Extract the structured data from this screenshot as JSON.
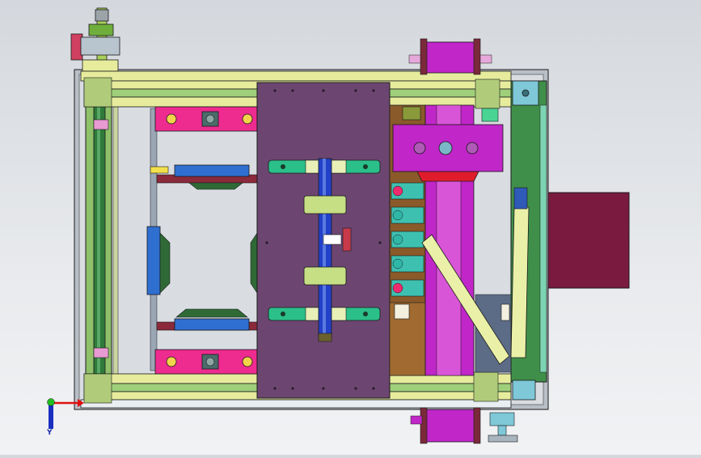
{
  "viewport": {
    "background_top": "#d4d8dd",
    "background_bottom": "#f1f2f4"
  },
  "colors": {
    "outline": "#1a1a1a",
    "frame_gray": "#b9bfc6",
    "rail_yellow": "#e6ec9c",
    "rail_green": "#8fc06a",
    "column_green": "#3f8f4a",
    "plate_purple": "#6c4670",
    "magenta": "#ee2b8f",
    "violet": "#c026c8",
    "clamp_green": "#2bbf8a",
    "rod_blue": "#2340c8",
    "bracket_blue": "#2f6fd0",
    "red_block": "#e01c2c",
    "maroon_box": "#7a1a3e",
    "brown_panel": "#8a5a2a",
    "teal": "#2fb7a8",
    "slate": "#5c6c86",
    "axis_x": "#e01010",
    "axis_y": "#1a2fc0",
    "axis_z": "#22aa22"
  },
  "axes": {
    "x_label": "",
    "y_label": "Y"
  },
  "icons": {
    "triad": "coordinate-triad-icon"
  }
}
